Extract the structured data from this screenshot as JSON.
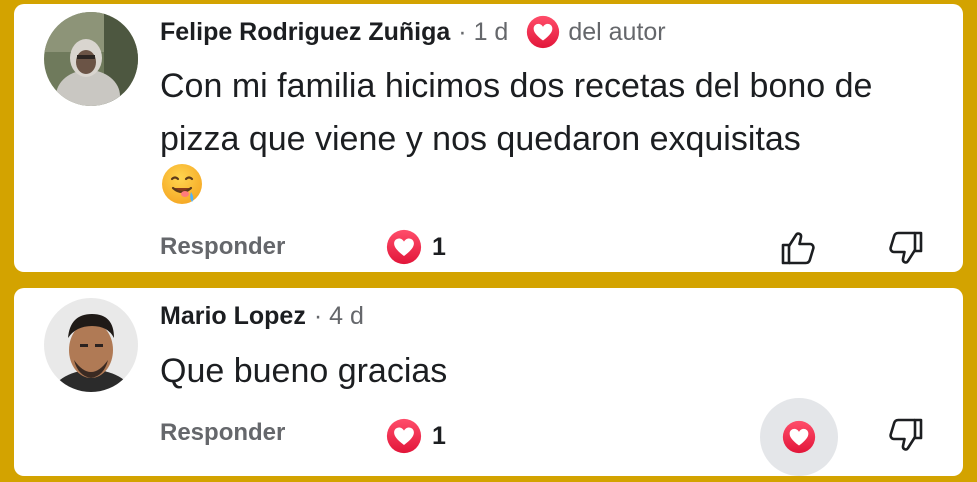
{
  "comments": [
    {
      "author": "Felipe Rodriguez Zuñiga",
      "time": "· 1 d",
      "author_badge_icon": "heart-reaction-icon",
      "author_badge_label": "del autor",
      "text": "Con mi familia hicimos dos recetas del bono de pizza que viene y nos quedaron exquisitas",
      "emoji": "drooling-face-emoji",
      "reply_label": "Responder",
      "reaction_icon": "heart-reaction-icon",
      "reaction_count": "1",
      "like_icon": "thumbs-up-icon",
      "dislike_icon": "thumbs-down-icon"
    },
    {
      "author": "Mario Lopez",
      "time": "· 4 d",
      "text": "Que bueno gracias",
      "reply_label": "Responder",
      "reaction_icon": "heart-reaction-icon",
      "reaction_count": "1",
      "selected_reaction_icon": "heart-reaction-icon",
      "dislike_icon": "thumbs-down-icon"
    }
  ],
  "colors": {
    "background": "#d3a300",
    "card": "#ffffff",
    "heart": "#f0284a",
    "secondary_text": "#65676b",
    "primary_text": "#1c1e21"
  }
}
